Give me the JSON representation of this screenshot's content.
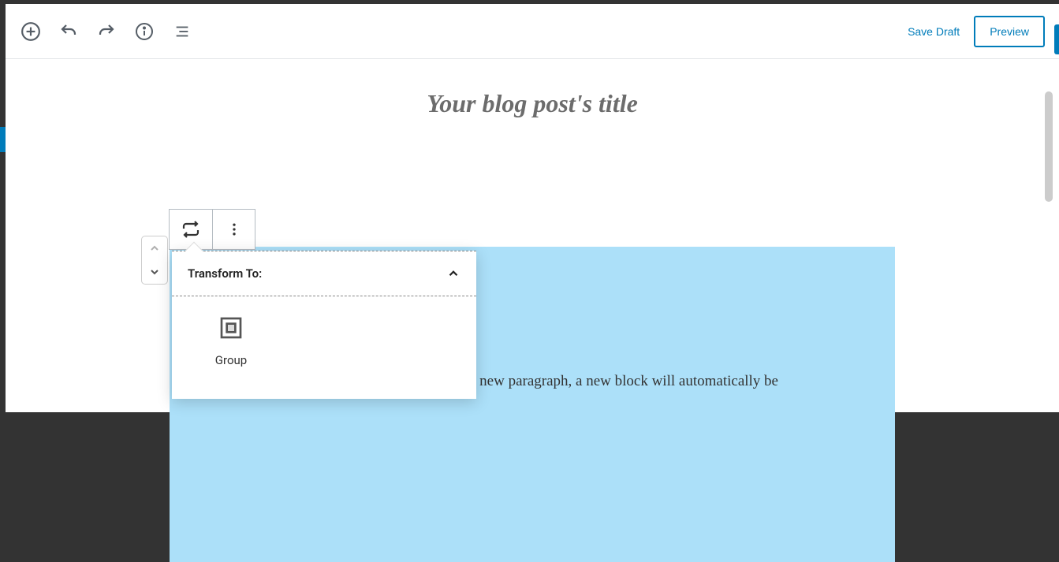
{
  "toolbar": {
    "save_draft": "Save Draft",
    "preview": "Preview"
  },
  "post": {
    "title_placeholder": "Your blog post's title",
    "content_visible": "a new paragraph, a new block will automatically be"
  },
  "block_toolbar": {
    "transform_icon": "transform",
    "more_icon": "more"
  },
  "transform_panel": {
    "title": "Transform To:",
    "options": [
      {
        "label": "Group",
        "icon": "group"
      }
    ]
  }
}
